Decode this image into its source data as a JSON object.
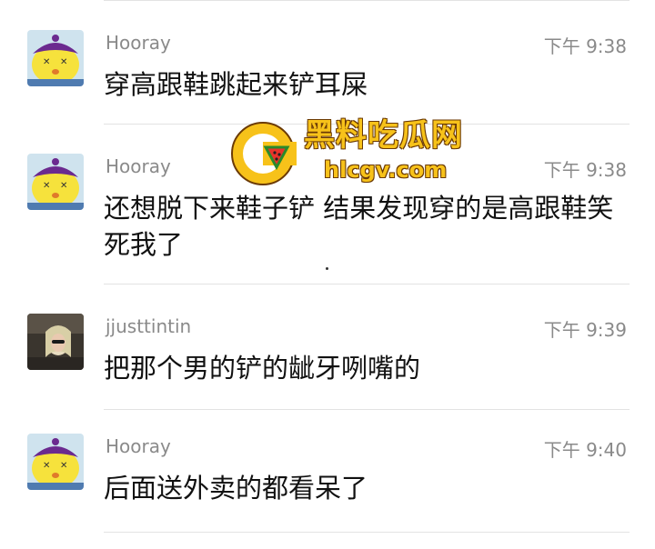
{
  "colors": {
    "background": "#ffffff",
    "sender_text": "#8a8a8a",
    "message_text": "#111111",
    "divider": "#e3e3e3",
    "watermark_fill": "#f7c21a",
    "watermark_outline": "#6b3a05"
  },
  "watermark": {
    "name": "黑料吃瓜网",
    "domain": "hlcgv.com"
  },
  "messages": [
    {
      "sender": "Hooray",
      "time": "下午 9:38",
      "text": "穿高跟鞋跳起来铲耳屎",
      "avatar": "yellow-cartoon-avatar-icon"
    },
    {
      "sender": "Hooray",
      "time": "下午 9:38",
      "text": "还想脱下来鞋子铲 结果发现穿的是高跟鞋笑死我了",
      "avatar": "yellow-cartoon-avatar-icon"
    },
    {
      "sender": "jjusttintin",
      "time": "下午 9:39",
      "text": "把那个男的铲的龇牙咧嘴的",
      "avatar": "photo-avatar-icon"
    },
    {
      "sender": "Hooray",
      "time": "下午 9:40",
      "text": "后面送外卖的都看呆了",
      "avatar": "yellow-cartoon-avatar-icon"
    }
  ]
}
